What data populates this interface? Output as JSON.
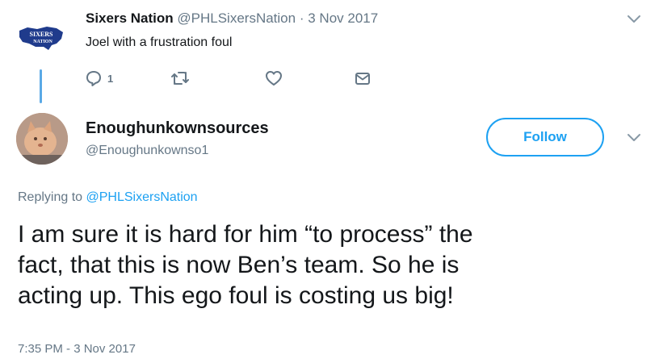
{
  "parent_tweet": {
    "name": "Sixers Nation",
    "handle": "@PHLSixersNation",
    "separator": "·",
    "date": "3 Nov 2017",
    "text": "Joel with a frustration foul",
    "logo_text_top": "SIXERS",
    "logo_text_bottom": "NATION",
    "reply_count": "1",
    "icons": [
      "reply-icon",
      "retweet-icon",
      "like-icon",
      "direct-message-icon",
      "chevron-down-icon"
    ]
  },
  "reply_tweet": {
    "name": "Enoughunkownsources",
    "handle": "@Enoughunkownso1",
    "follow_label": "Follow",
    "replying_prefix": "Replying to",
    "replying_mention": "@PHLSixersNation",
    "text_lines": [
      "I am sure it is hard for him “to process” the",
      "fact, that this is now Ben’s team. So he is",
      "acting up. This ego foul is costing us big!"
    ],
    "timestamp": "7:35 PM - 3 Nov 2017"
  },
  "colors": {
    "accent": "#1da1f2",
    "secondary_text": "#657786",
    "primary_text": "#14171a",
    "logo_blue": "#1f3b8c"
  }
}
